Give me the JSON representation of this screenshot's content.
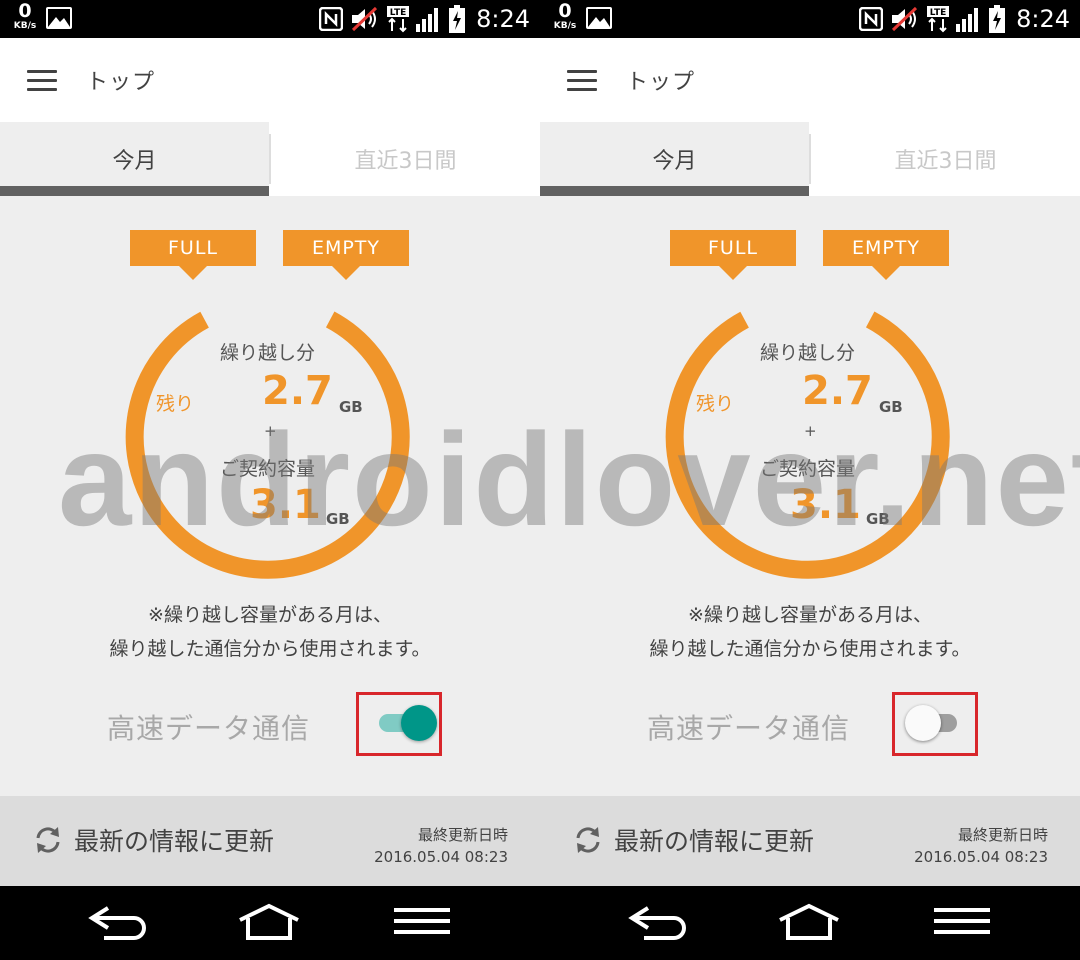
{
  "status_bar": {
    "speed_value": "0",
    "speed_unit": "KB/s",
    "network_type": "LTE",
    "time": "8:24"
  },
  "app_bar": {
    "title": "トップ"
  },
  "tabs": [
    {
      "label": "今月",
      "active": true
    },
    {
      "label": "直近3日間",
      "active": false
    }
  ],
  "gauge": {
    "full_label": "FULL",
    "empty_label": "EMPTY",
    "carryover_label": "繰り越し分",
    "remaining_label": "残り",
    "carryover_value": "2.7",
    "carryover_unit": "GB",
    "plus": "+",
    "contract_label": "ご契約容量",
    "contract_value": "3.1",
    "contract_unit": "GB",
    "accent_color": "#f0952a"
  },
  "note": {
    "line1": "※繰り越し容量がある月は、",
    "line2": "繰り越した通信分から使用されます。"
  },
  "high_speed": {
    "label": "高速データ通信",
    "left_screen_on": true,
    "right_screen_on": false
  },
  "refresh": {
    "label": "最新の情報に更新",
    "updated_label": "最終更新日時",
    "updated_time": "2016.05.04 08:23"
  },
  "nav_icons": [
    "back-icon",
    "home-icon",
    "menu-icon"
  ],
  "watermark": "androidlover.net"
}
